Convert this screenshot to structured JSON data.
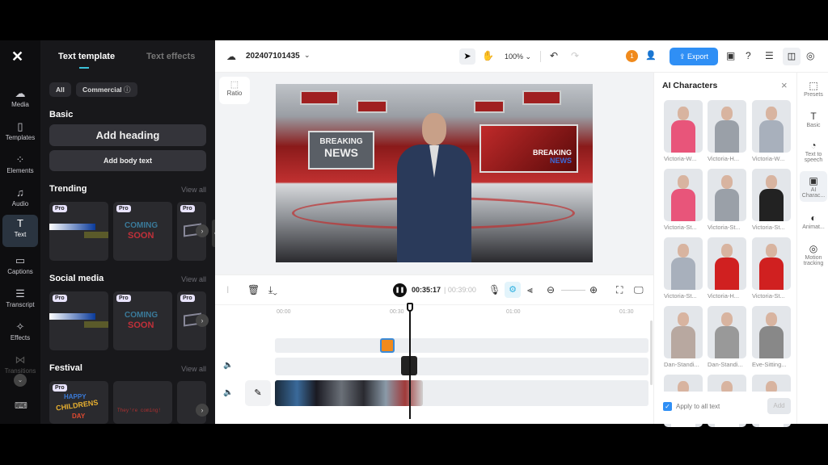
{
  "rail": {
    "items": [
      {
        "label": "Media",
        "icon": "cloud-upload-icon"
      },
      {
        "label": "Templates",
        "icon": "templates-icon"
      },
      {
        "label": "Elements",
        "icon": "elements-icon"
      },
      {
        "label": "Audio",
        "icon": "music-icon"
      },
      {
        "label": "Text",
        "icon": "text-icon",
        "active": true
      },
      {
        "label": "Captions",
        "icon": "captions-icon"
      },
      {
        "label": "Transcript",
        "icon": "transcript-icon"
      },
      {
        "label": "Effects",
        "icon": "effects-icon"
      },
      {
        "label": "Transitions",
        "icon": "transitions-icon"
      }
    ]
  },
  "left_panel": {
    "tabs": [
      "Text template",
      "Text effects"
    ],
    "filters": [
      "All",
      "Commercial"
    ],
    "basic": {
      "title": "Basic",
      "add_heading": "Add heading",
      "add_body": "Add body text"
    },
    "sections": [
      {
        "title": "Trending",
        "view_all": "View all"
      },
      {
        "title": "Social media",
        "view_all": "View all"
      },
      {
        "title": "Festival",
        "view_all": "View all"
      }
    ],
    "pro_badge": "Pro",
    "card_texts": {
      "coming": "COMING",
      "soon": "SOON",
      "happy": "HAPPY",
      "childrens": "CHILDRENS",
      "day": "DAY",
      "theyre": "They're coming!"
    }
  },
  "header": {
    "project_name": "202407101435",
    "zoom": "100%",
    "export": "Export",
    "notification_count": "1"
  },
  "canvas": {
    "ratio": "Ratio",
    "studio_text_1": "BREAKING",
    "studio_text_2": "NEWS"
  },
  "timeline": {
    "current_time": "00:35:17",
    "total_time": "00:39:00",
    "ticks": [
      "00:00",
      "00:30",
      "01:00",
      "01:30"
    ],
    "playhead_progress": 0.39
  },
  "right_panel": {
    "title": "AI Characters",
    "characters": [
      "Victoria-W...",
      "Victoria-H...",
      "Victoria-W...",
      "Victoria-St...",
      "Victoria-St...",
      "Victoria-St...",
      "Victoria-St...",
      "Victoria-H...",
      "Victoria-St...",
      "Dan-Standi...",
      "Dan-Standi...",
      "Eve-Sitting...",
      "",
      "",
      ""
    ],
    "apply_all": "Apply to all text",
    "apply_checked": true,
    "add": "Add"
  },
  "right_rail": {
    "items": [
      "Presets",
      "Basic",
      "Text to speech",
      "AI Charac...",
      "Animat...",
      "Motion tracking"
    ]
  },
  "colors": {
    "accent": "#2f8ff5",
    "active_rail": "#2a3440"
  }
}
